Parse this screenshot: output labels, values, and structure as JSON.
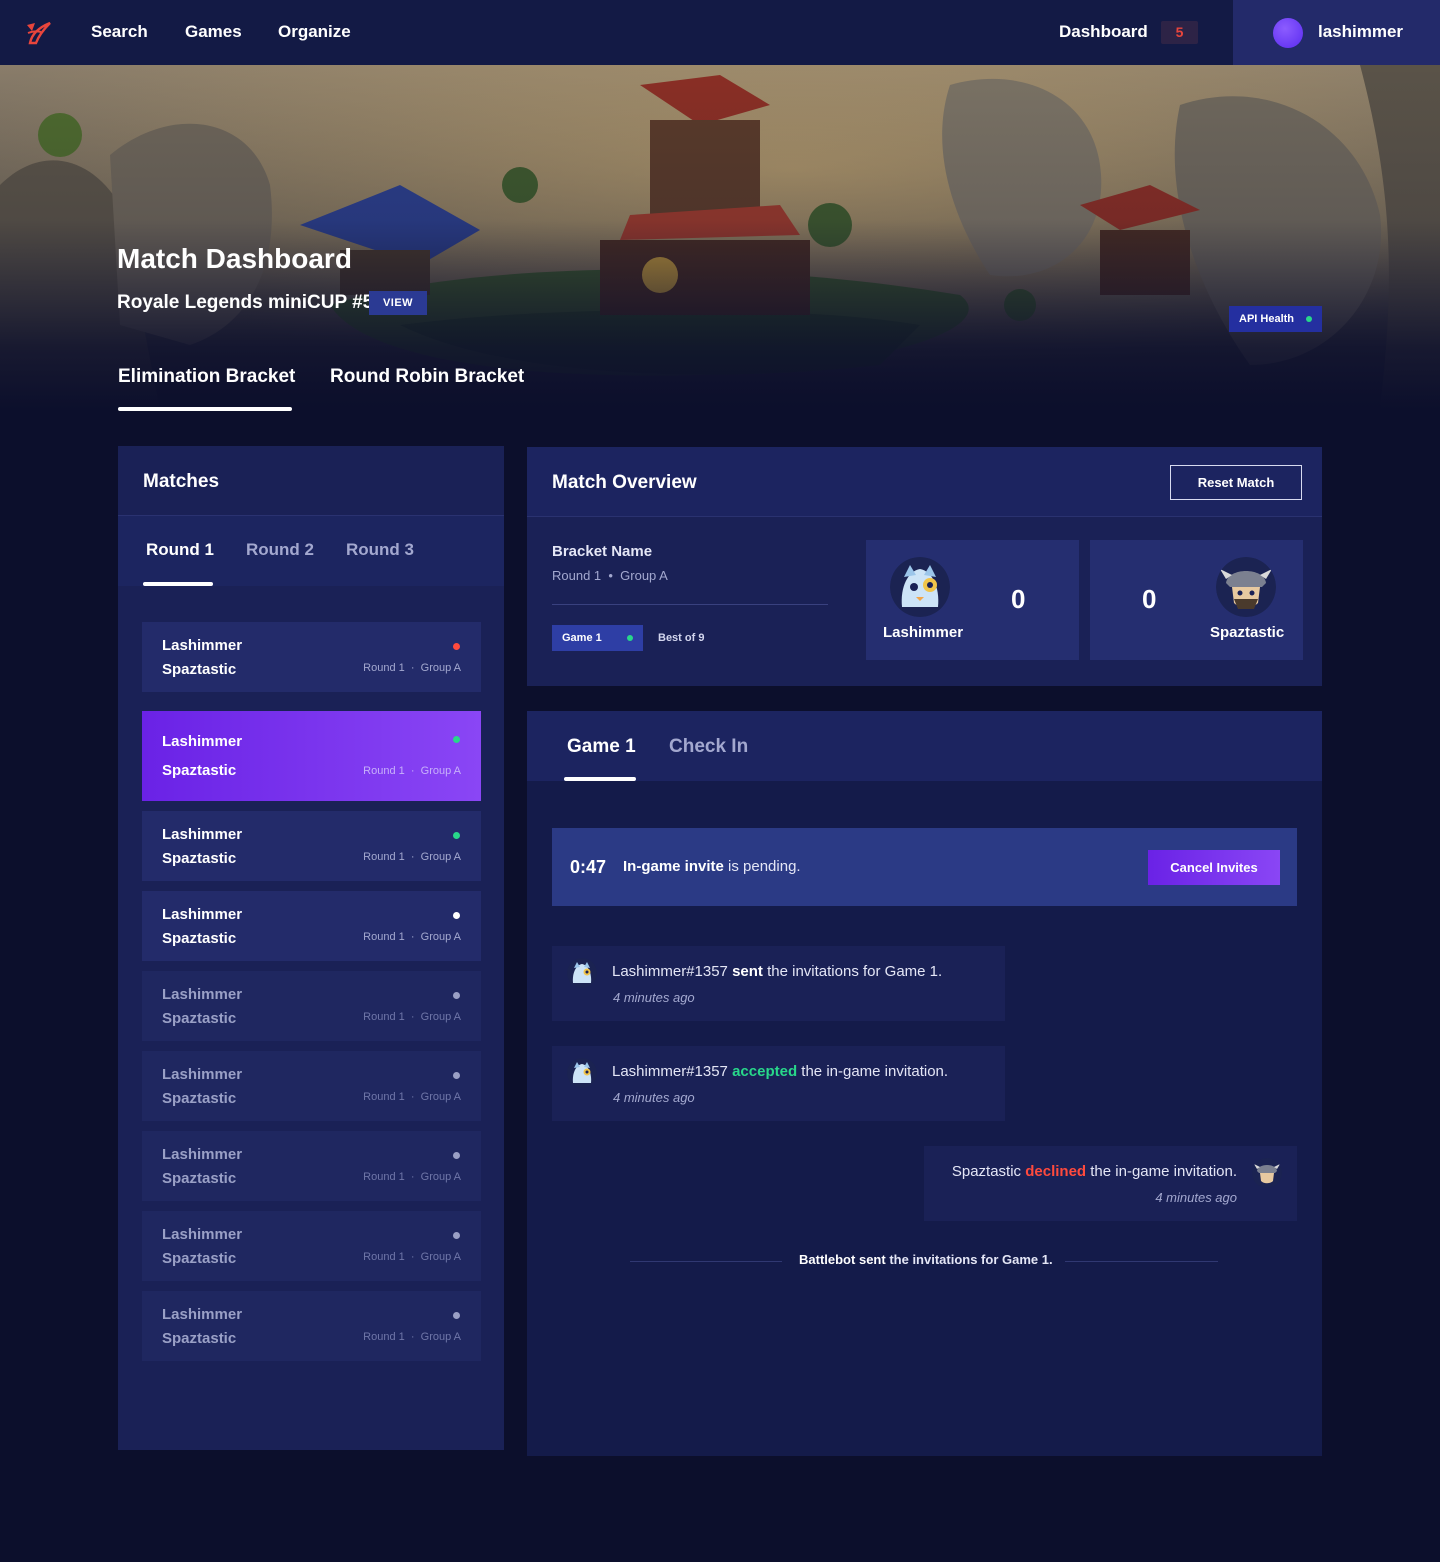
{
  "nav": {
    "links": [
      "Search",
      "Games",
      "Organize"
    ],
    "dashboard_label": "Dashboard",
    "dashboard_badge": "5",
    "username": "lashimmer"
  },
  "hero": {
    "title": "Match Dashboard",
    "event_name": "Royale Legends miniCUP #5",
    "view_label": "VIEW",
    "api_health_label": "API Health",
    "bracket_tabs": [
      "Elimination Bracket",
      "Round Robin Bracket"
    ]
  },
  "matches": {
    "title": "Matches",
    "round_tabs": [
      "Round 1",
      "Round 2",
      "Round 3"
    ],
    "list": [
      {
        "p1": "Lashimmer",
        "p2": "Spaztastic",
        "round": "Round 1",
        "group": "Group A",
        "status_color": "#ff4a3d"
      },
      {
        "p1": "Lashimmer",
        "p2": "Spaztastic",
        "round": "Round 1",
        "group": "Group A",
        "status_color": "#28d78a"
      },
      {
        "p1": "Lashimmer",
        "p2": "Spaztastic",
        "round": "Round 1",
        "group": "Group A",
        "status_color": "#28d78a"
      },
      {
        "p1": "Lashimmer",
        "p2": "Spaztastic",
        "round": "Round 1",
        "group": "Group A",
        "status_color": "#ffffff"
      },
      {
        "p1": "Lashimmer",
        "p2": "Spaztastic",
        "round": "Round 1",
        "group": "Group A",
        "status_color": "#9aa0c6"
      },
      {
        "p1": "Lashimmer",
        "p2": "Spaztastic",
        "round": "Round 1",
        "group": "Group A",
        "status_color": "#9aa0c6"
      },
      {
        "p1": "Lashimmer",
        "p2": "Spaztastic",
        "round": "Round 1",
        "group": "Group A",
        "status_color": "#9aa0c6"
      },
      {
        "p1": "Lashimmer",
        "p2": "Spaztastic",
        "round": "Round 1",
        "group": "Group A",
        "status_color": "#9aa0c6"
      },
      {
        "p1": "Lashimmer",
        "p2": "Spaztastic",
        "round": "Round 1",
        "group": "Group A",
        "status_color": "#9aa0c6"
      }
    ]
  },
  "overview": {
    "title": "Match Overview",
    "reset_label": "Reset Match",
    "bracket_name": "Bracket Name",
    "round": "Round 1",
    "group": "Group A",
    "game_chip": "Game 1",
    "best_of": "Best of 9",
    "player1": {
      "name": "Lashimmer",
      "score": "0"
    },
    "player2": {
      "name": "Spaztastic",
      "score": "0"
    }
  },
  "game": {
    "tabs": [
      "Game 1",
      "Check In"
    ],
    "timer": "0:47",
    "invite_bold": "In-game invite",
    "invite_rest": "is pending.",
    "cancel_label": "Cancel Invites",
    "log": [
      {
        "actor": "Lashimmer#1357",
        "verb": "sent",
        "rest": "the invitations for Game 1.",
        "time": "4 minutes ago"
      },
      {
        "actor": "Lashimmer#1357",
        "verb": "accepted",
        "rest": "the in-game invitation.",
        "time": "4 minutes ago"
      },
      {
        "actor": "Spaztastic",
        "verb": "declined",
        "rest": "the in-game invitation.",
        "time": "4 minutes ago"
      }
    ],
    "system_actor": "Battlebot",
    "system_verb": "sent",
    "system_rest": "the invitations for Game 1."
  },
  "colors": {
    "accent": "#7b35f0",
    "success": "#28d78a",
    "danger": "#ff4a3d",
    "background": "#0c0f2c",
    "panel": "#1a2156"
  }
}
